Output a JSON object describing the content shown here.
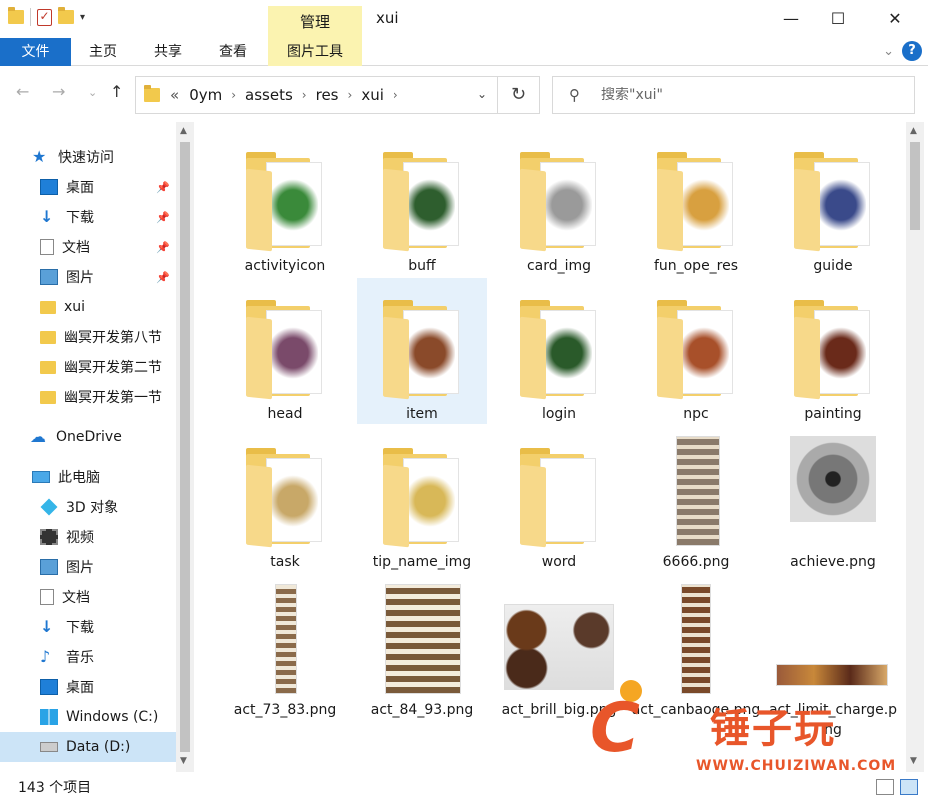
{
  "window": {
    "title": "xui",
    "manage_tab": "管理",
    "minimize": "—",
    "maximize": "☐",
    "close": "✕"
  },
  "ribbon": {
    "tabs": [
      "文件",
      "主页",
      "共享",
      "查看",
      "图片工具"
    ],
    "help": "?"
  },
  "address": {
    "overflow": "«",
    "crumbs": [
      "0ym",
      "assets",
      "res",
      "xui"
    ]
  },
  "search": {
    "placeholder": "搜索\"xui\""
  },
  "sidebar": {
    "items": [
      {
        "label": "快速访问",
        "icon": "star-icon"
      },
      {
        "label": "桌面",
        "icon": "desktop-icon",
        "pinned": true
      },
      {
        "label": "下载",
        "icon": "download-icon",
        "pinned": true
      },
      {
        "label": "文档",
        "icon": "document-icon",
        "pinned": true
      },
      {
        "label": "图片",
        "icon": "pictures-icon",
        "pinned": true
      },
      {
        "label": "xui",
        "icon": "folder-icon"
      },
      {
        "label": "幽冥开发第八节",
        "icon": "folder-icon"
      },
      {
        "label": "幽冥开发第二节",
        "icon": "folder-icon"
      },
      {
        "label": "幽冥开发第一节",
        "icon": "folder-icon"
      },
      {
        "label": "OneDrive",
        "icon": "onedrive-icon"
      },
      {
        "label": "此电脑",
        "icon": "this-pc-icon"
      },
      {
        "label": "3D 对象",
        "icon": "3d-objects-icon"
      },
      {
        "label": "视频",
        "icon": "video-icon"
      },
      {
        "label": "图片",
        "icon": "pictures-icon"
      },
      {
        "label": "文档",
        "icon": "document-icon"
      },
      {
        "label": "下载",
        "icon": "download-icon"
      },
      {
        "label": "音乐",
        "icon": "music-icon"
      },
      {
        "label": "桌面",
        "icon": "desktop-icon"
      },
      {
        "label": "Windows (C:)",
        "icon": "windows-drive-icon"
      },
      {
        "label": "Data (D:)",
        "icon": "drive-icon",
        "selected": true
      }
    ]
  },
  "files": [
    {
      "name": "activityicon",
      "kind": "folder",
      "thumb": "#3a8a3a"
    },
    {
      "name": "buff",
      "kind": "folder",
      "thumb": "#2e5e2e"
    },
    {
      "name": "card_img",
      "kind": "folder",
      "thumb": "#9a9a9a"
    },
    {
      "name": "fun_ope_res",
      "kind": "folder",
      "thumb": "#d8a040"
    },
    {
      "name": "guide",
      "kind": "folder",
      "thumb": "#3a4a8a"
    },
    {
      "name": "head",
      "kind": "folder",
      "thumb": "#7a4a6a"
    },
    {
      "name": "item",
      "kind": "folder",
      "thumb": "#8a4a2a",
      "selected": true
    },
    {
      "name": "login",
      "kind": "folder",
      "thumb": "#2a5a2a"
    },
    {
      "name": "npc",
      "kind": "folder",
      "thumb": "#a8502a"
    },
    {
      "name": "painting",
      "kind": "folder",
      "thumb": "#6a2a1a"
    },
    {
      "name": "task",
      "kind": "folder",
      "thumb": "#c8a868"
    },
    {
      "name": "tip_name_img",
      "kind": "folder",
      "thumb": "#d8b858"
    },
    {
      "name": "word",
      "kind": "folder",
      "thumb": "#ffffff"
    },
    {
      "name": "6666.png",
      "kind": "image",
      "thumb": "#8a7a6a"
    },
    {
      "name": "achieve.png",
      "kind": "image",
      "thumb": "#5a5a5a"
    },
    {
      "name": "act_73_83.png",
      "kind": "image",
      "thumb": "#8a6a4a"
    },
    {
      "name": "act_84_93.png",
      "kind": "image",
      "thumb": "#7a5a3a"
    },
    {
      "name": "act_brill_big.png",
      "kind": "image",
      "thumb": "#6a3a1a"
    },
    {
      "name": "act_canbaoge.png",
      "kind": "image",
      "thumb": "#7a4a2a"
    },
    {
      "name": "act_limit_charge.png",
      "kind": "image",
      "thumb": "#9a5a3a"
    }
  ],
  "status": {
    "count": "143 个项目"
  },
  "watermark": {
    "brand": "锤子玩",
    "url": "WWW.CHUIZIWAN.COM",
    "letter": "C"
  }
}
